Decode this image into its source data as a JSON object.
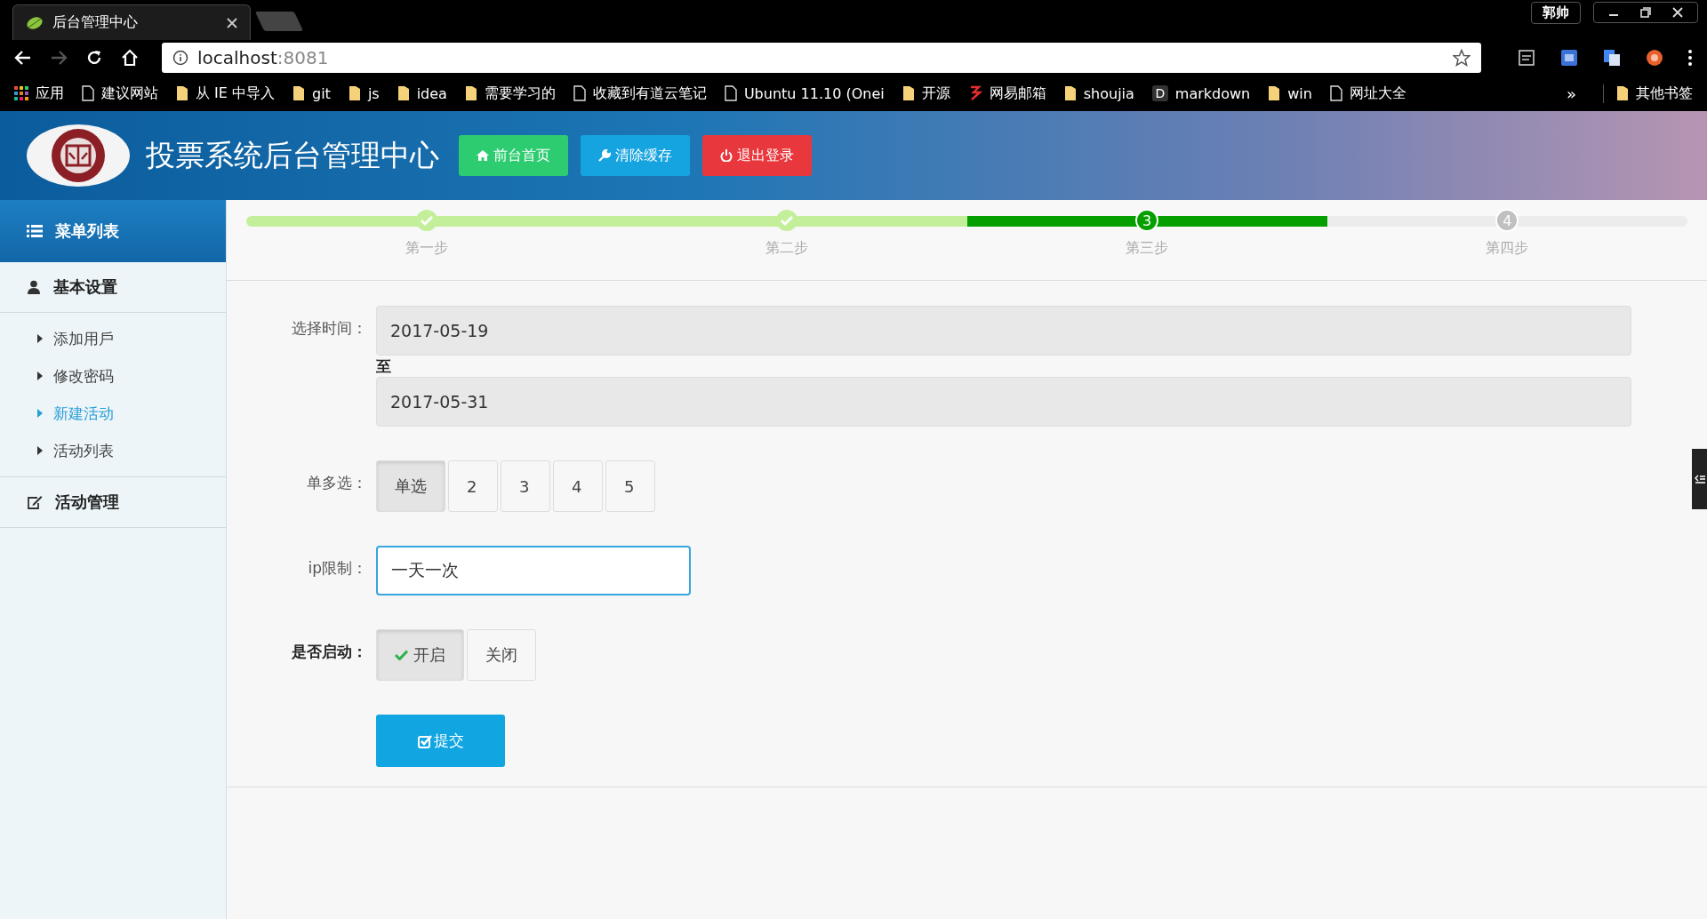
{
  "browser": {
    "tab_title": "后台管理中心",
    "profile": "郭帅",
    "address": {
      "host": "localhost",
      "port": ":8081"
    },
    "bookmarks": [
      {
        "kind": "apps",
        "label": "应用"
      },
      {
        "kind": "page",
        "label": "建议网站"
      },
      {
        "kind": "folder",
        "label": "从 IE 中导入"
      },
      {
        "kind": "folder",
        "label": "git"
      },
      {
        "kind": "folder",
        "label": "js"
      },
      {
        "kind": "folder",
        "label": "idea"
      },
      {
        "kind": "folder",
        "label": "需要学习的"
      },
      {
        "kind": "page",
        "label": "收藏到有道云笔记"
      },
      {
        "kind": "page",
        "label": "Ubuntu 11.10 (Onei"
      },
      {
        "kind": "folder",
        "label": "开源"
      },
      {
        "kind": "mail",
        "label": "网易邮箱"
      },
      {
        "kind": "folder",
        "label": "shoujia"
      },
      {
        "kind": "letter",
        "icon_letter": "D",
        "label": "markdown"
      },
      {
        "kind": "folder",
        "label": "win"
      },
      {
        "kind": "page",
        "label": "网址大全"
      }
    ],
    "overflow": "»",
    "other_bookmarks": "其他书签"
  },
  "header": {
    "title": "投票系统后台管理中心",
    "buttons": [
      {
        "kind": "home",
        "label": "前台首页"
      },
      {
        "kind": "clear",
        "label": "清除缓存"
      },
      {
        "kind": "logout",
        "label": "退出登录"
      }
    ]
  },
  "sidebar": {
    "heading": "菜单列表",
    "sections": [
      {
        "kind": "user",
        "label": "基本设置",
        "children": [
          {
            "label": "添加用戶",
            "selected": false
          },
          {
            "label": "修改密码",
            "selected": false
          },
          {
            "label": "新建活动",
            "selected": true
          },
          {
            "label": "活动列表",
            "selected": false
          }
        ]
      },
      {
        "kind": "edit",
        "label": "活动管理"
      }
    ]
  },
  "steps": [
    {
      "label": "第一步",
      "kind": "done",
      "selected": false
    },
    {
      "label": "第二步",
      "kind": "done",
      "selected": false
    },
    {
      "label": "第三步",
      "kind": "todo",
      "number": "3",
      "selected": true
    },
    {
      "label": "第四步",
      "kind": "todo",
      "number": "4",
      "selected": false
    }
  ],
  "form": {
    "date_label": "选择时间：",
    "start_date": "2017-05-19",
    "date_separator": "至",
    "end_date": "2017-05-31",
    "choice_label": "单多选：",
    "choices": [
      {
        "label": "单选",
        "selected": true
      },
      {
        "label": "2",
        "selected": false
      },
      {
        "label": "3",
        "selected": false
      },
      {
        "label": "4",
        "selected": false
      },
      {
        "label": "5",
        "selected": false
      }
    ],
    "ip_label": "ip限制：",
    "ip_value": "一天一次",
    "enable_label": "是否启动：",
    "enable_options": [
      {
        "label": "开启",
        "selected": true
      },
      {
        "label": "关闭",
        "selected": false
      }
    ],
    "submit": "提交"
  }
}
